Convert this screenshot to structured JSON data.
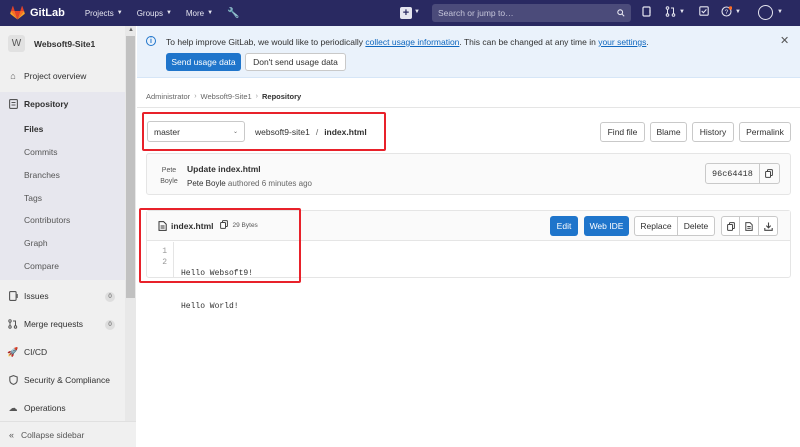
{
  "navbar": {
    "logo_text": "GitLab",
    "menu": [
      {
        "label": "Projects"
      },
      {
        "label": "Groups"
      },
      {
        "label": "More"
      }
    ],
    "search_placeholder": "Search or jump to…"
  },
  "sidebar": {
    "project_avatar": "W",
    "project_name": "Websoft9-Site1",
    "items": {
      "overview": "Project overview",
      "repository": "Repository",
      "issues": "Issues",
      "issues_count": "0",
      "merge_requests": "Merge requests",
      "merge_requests_count": "0",
      "cicd": "CI/CD",
      "security": "Security & Compliance",
      "operations": "Operations"
    },
    "repository_sub": [
      "Files",
      "Commits",
      "Branches",
      "Tags",
      "Contributors",
      "Graph",
      "Compare"
    ],
    "collapse": "Collapse sidebar"
  },
  "banner": {
    "text_before": "To help improve GitLab, we would like to periodically ",
    "link1": "collect usage information",
    "text_middle": ". This can be changed at any time in ",
    "link2": "your settings",
    "text_end": ".",
    "send_button": "Send usage data",
    "dont_send_button": "Don't send usage data"
  },
  "breadcrumb": [
    "Administrator",
    "Websoft9-Site1",
    "Repository"
  ],
  "file_nav": {
    "branch": "master",
    "repo": "websoft9-site1",
    "separator": "/",
    "file": "index.html",
    "buttons": [
      "Find file",
      "Blame",
      "History",
      "Permalink"
    ]
  },
  "commit": {
    "avatar_text": "Pete Boyle",
    "title": "Update index.html",
    "author": "Pete Boyle",
    "authored": " authored 6 minutes ago",
    "sha": "96c64418"
  },
  "file": {
    "name": "index.html",
    "size": "29 Bytes",
    "buttons": {
      "edit": "Edit",
      "web_ide": "Web IDE",
      "replace": "Replace",
      "delete": "Delete"
    },
    "line_numbers": [
      "1",
      "2"
    ],
    "lines": [
      "Hello Websoft9!",
      "Hello World!"
    ]
  },
  "colors": {
    "navbar": "#292961",
    "primary": "#1f75cb",
    "highlight": "#e8212a"
  }
}
